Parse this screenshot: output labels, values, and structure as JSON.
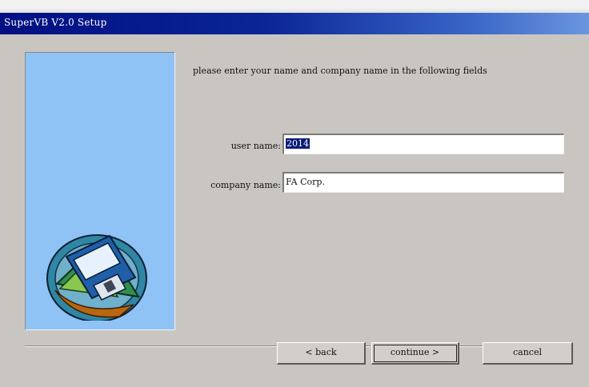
{
  "window": {
    "title": "SuperVB V2.0 Setup"
  },
  "side_panel": {
    "art_icon": "floppy-disk-install-icon"
  },
  "form": {
    "instruction": "please enter your name and company name  in the following fields",
    "user_name_label": "user name:",
    "user_name_value": "2014",
    "company_name_label": "company name:",
    "company_name_value": "FA Corp."
  },
  "buttons": {
    "back_label": "< back",
    "continue_label": "continue >",
    "cancel_label": "cancel"
  },
  "colors": {
    "titlebar_start": "#000f82",
    "titlebar_end": "#6b96de",
    "side_panel": "#8fc2f5",
    "dialog_bg": "#c9c6c1",
    "selection": "#0a1b7a"
  }
}
